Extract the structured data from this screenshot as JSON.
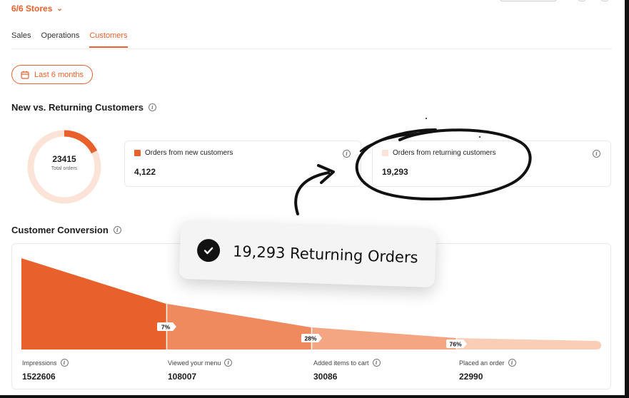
{
  "header": {
    "stores_label": "6/6 Stores"
  },
  "tabs": [
    {
      "label": "Sales",
      "active": false
    },
    {
      "label": "Operations",
      "active": false
    },
    {
      "label": "Customers",
      "active": true
    }
  ],
  "date_filter": {
    "label": "Last 6 months"
  },
  "new_vs_returning": {
    "title": "New vs. Returning Customers",
    "donut": {
      "total_value": "23415",
      "total_label": "Total orders",
      "new_fraction": 0.176
    },
    "cards": [
      {
        "label": "Orders from new customers",
        "value": "4,122",
        "color": "#e8612c"
      },
      {
        "label": "Orders from returning customers",
        "value": "19,293",
        "color": "#fbe3d7"
      }
    ]
  },
  "customer_conversion": {
    "title": "Customer Conversion",
    "stages": [
      {
        "label": "Impressions",
        "value": "1522606"
      },
      {
        "label": "Viewed your menu",
        "value": "108007"
      },
      {
        "label": "Added items to cart",
        "value": "30086"
      },
      {
        "label": "Placed an order",
        "value": "22990"
      }
    ],
    "rates": [
      "7%",
      "28%",
      "76%"
    ]
  },
  "callout": {
    "text": "19,293 Returning Orders"
  },
  "colors": {
    "accent": "#e8612c",
    "accent_light": "#fbe3d7"
  }
}
